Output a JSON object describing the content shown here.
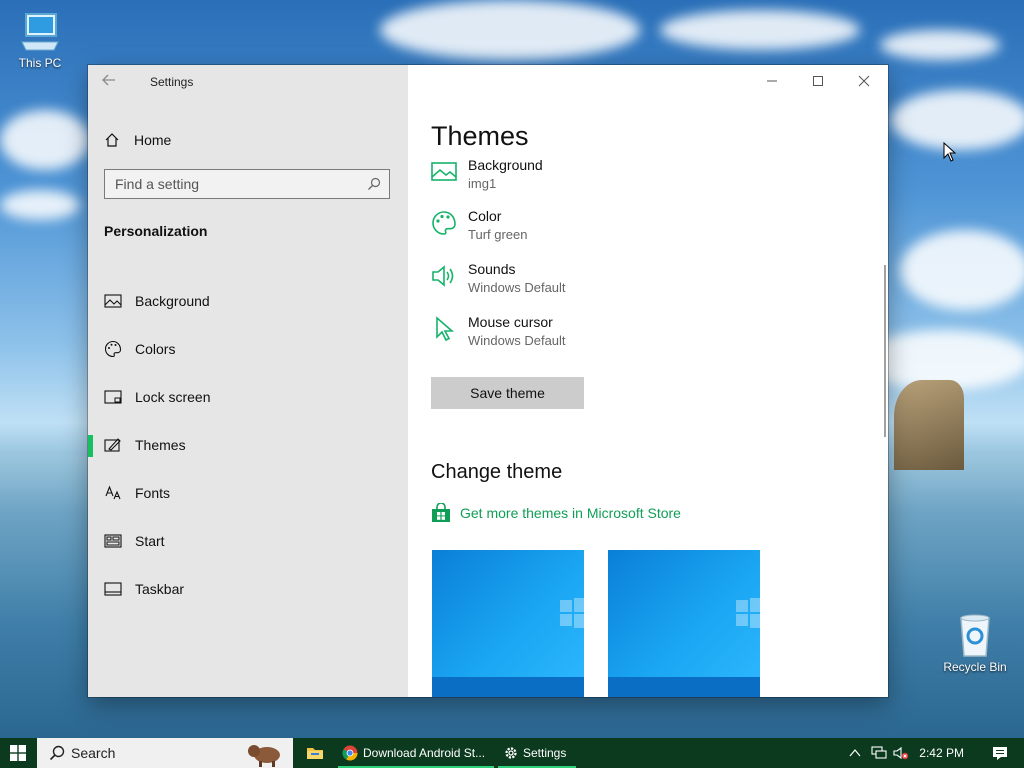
{
  "desktop": {
    "icons": [
      {
        "label": "This PC"
      },
      {
        "label": "Recycle Bin"
      }
    ]
  },
  "settings": {
    "title": "Settings",
    "home_label": "Home",
    "search_placeholder": "Find a setting",
    "section_label": "Personalization",
    "nav_items": [
      {
        "label": "Background",
        "icon": "image-icon"
      },
      {
        "label": "Colors",
        "icon": "palette-icon"
      },
      {
        "label": "Lock screen",
        "icon": "lock-screen-icon"
      },
      {
        "label": "Themes",
        "icon": "themes-icon",
        "active": true
      },
      {
        "label": "Fonts",
        "icon": "fonts-icon"
      },
      {
        "label": "Start",
        "icon": "start-icon"
      },
      {
        "label": "Taskbar",
        "icon": "taskbar-icon"
      }
    ],
    "accent_color": "#16c060"
  },
  "themes": {
    "heading": "Themes",
    "items": [
      {
        "title": "Background",
        "value": "img1"
      },
      {
        "title": "Color",
        "value": "Turf green"
      },
      {
        "title": "Sounds",
        "value": "Windows Default"
      },
      {
        "title": "Mouse cursor",
        "value": "Windows Default"
      }
    ],
    "save_label": "Save theme",
    "change_heading": "Change theme",
    "store_link": "Get more themes in Microsoft Store"
  },
  "taskbar": {
    "search_placeholder": "Search",
    "apps": [
      {
        "label": "Download Android St..."
      },
      {
        "label": "Settings"
      }
    ],
    "clock": "2:42 PM"
  }
}
